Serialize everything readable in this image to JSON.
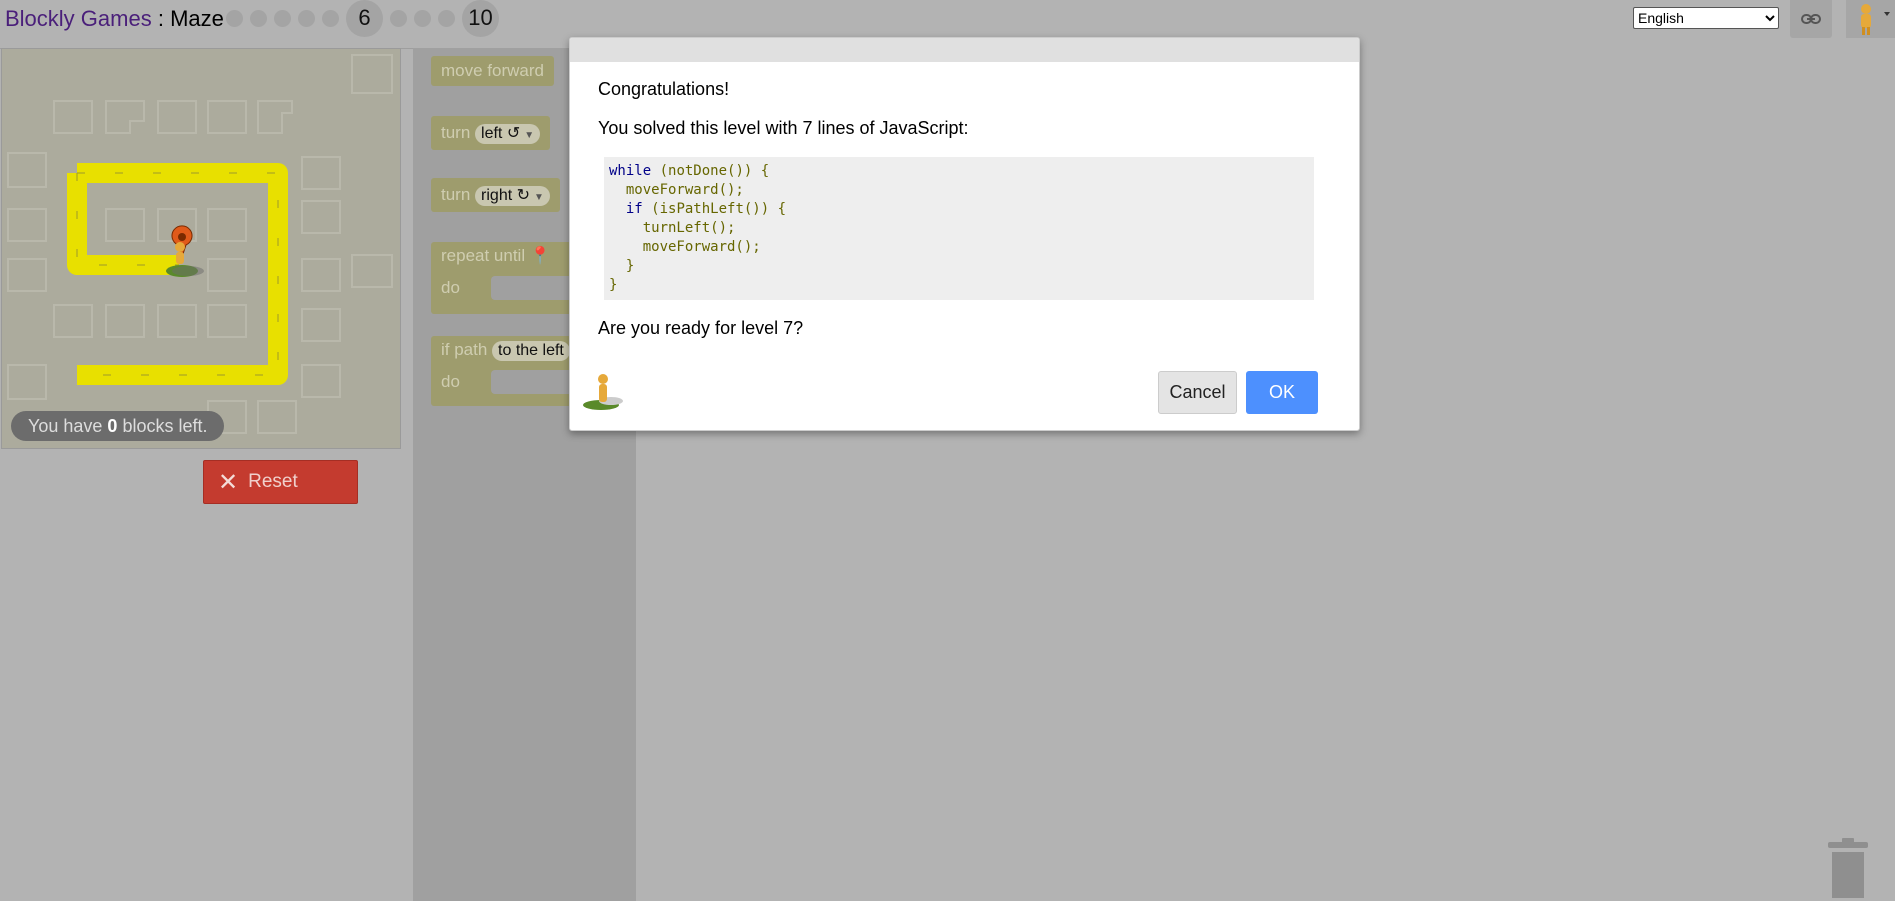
{
  "header": {
    "brand": "Blockly Games",
    "separator": " : ",
    "game": "Maze",
    "levels": [
      {
        "label": "",
        "current": false,
        "shown": false
      },
      {
        "label": "",
        "current": false,
        "shown": false
      },
      {
        "label": "",
        "current": false,
        "shown": false
      },
      {
        "label": "",
        "current": false,
        "shown": false
      },
      {
        "label": "",
        "current": false,
        "shown": false
      },
      {
        "label": "6",
        "current": true,
        "shown": true
      },
      {
        "label": "",
        "current": false,
        "shown": false
      },
      {
        "label": "",
        "current": false,
        "shown": false
      },
      {
        "label": "",
        "current": false,
        "shown": false
      },
      {
        "label": "10",
        "current": false,
        "shown": true
      }
    ],
    "language": "English",
    "link_icon": "link-icon",
    "pegman_icon": "pegman-icon"
  },
  "maze": {
    "blocks_left_prefix": "You have ",
    "blocks_left_count": "0",
    "blocks_left_suffix": " blocks left.",
    "path_color": "#e8e000"
  },
  "reset_button": {
    "label": "Reset",
    "icon": "close-icon",
    "color": "#c43b2f"
  },
  "toolbox": {
    "move_forward": "move forward",
    "turn_word": "turn",
    "turn_left_value": "left ↺",
    "turn_right_value": "right ↻",
    "repeat_until": "repeat until",
    "do_label": "do",
    "if_path": "if path",
    "if_path_value": "to the left"
  },
  "dialog": {
    "congrats": "Congratulations!",
    "solved": "You solved this level with 7 lines of JavaScript:",
    "code_lines": [
      "while (notDone()) {",
      "  moveForward();",
      "  if (isPathLeft()) {",
      "    turnLeft();",
      "    moveForward();",
      "  }",
      "}"
    ],
    "ready": "Are you ready for level 7?",
    "cancel_label": "Cancel",
    "ok_label": "OK",
    "ok_color": "#4d90fe"
  }
}
